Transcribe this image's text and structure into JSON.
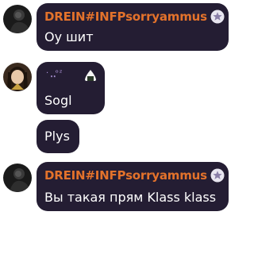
{
  "messages": [
    {
      "sender": "DREIN#INFPsorryammus",
      "text": "Оу шит",
      "badge": "star-badge-icon",
      "name_color": "#e3722b"
    },
    {
      "sender": "· ̥͙ ̥͙ᵒᶻ",
      "sender_emoji": "onigiri-icon",
      "text": "Sogl"
    },
    {
      "text": "Plys"
    },
    {
      "sender": "DREIN#INFPsorryammus",
      "text": "Вы такая прям Klass klass",
      "badge": "star-badge-icon",
      "name_color": "#e3722b"
    }
  ],
  "colors": {
    "bubble_bg": "#241d33",
    "name_accent": "#e3722b",
    "text": "#ffffff"
  }
}
